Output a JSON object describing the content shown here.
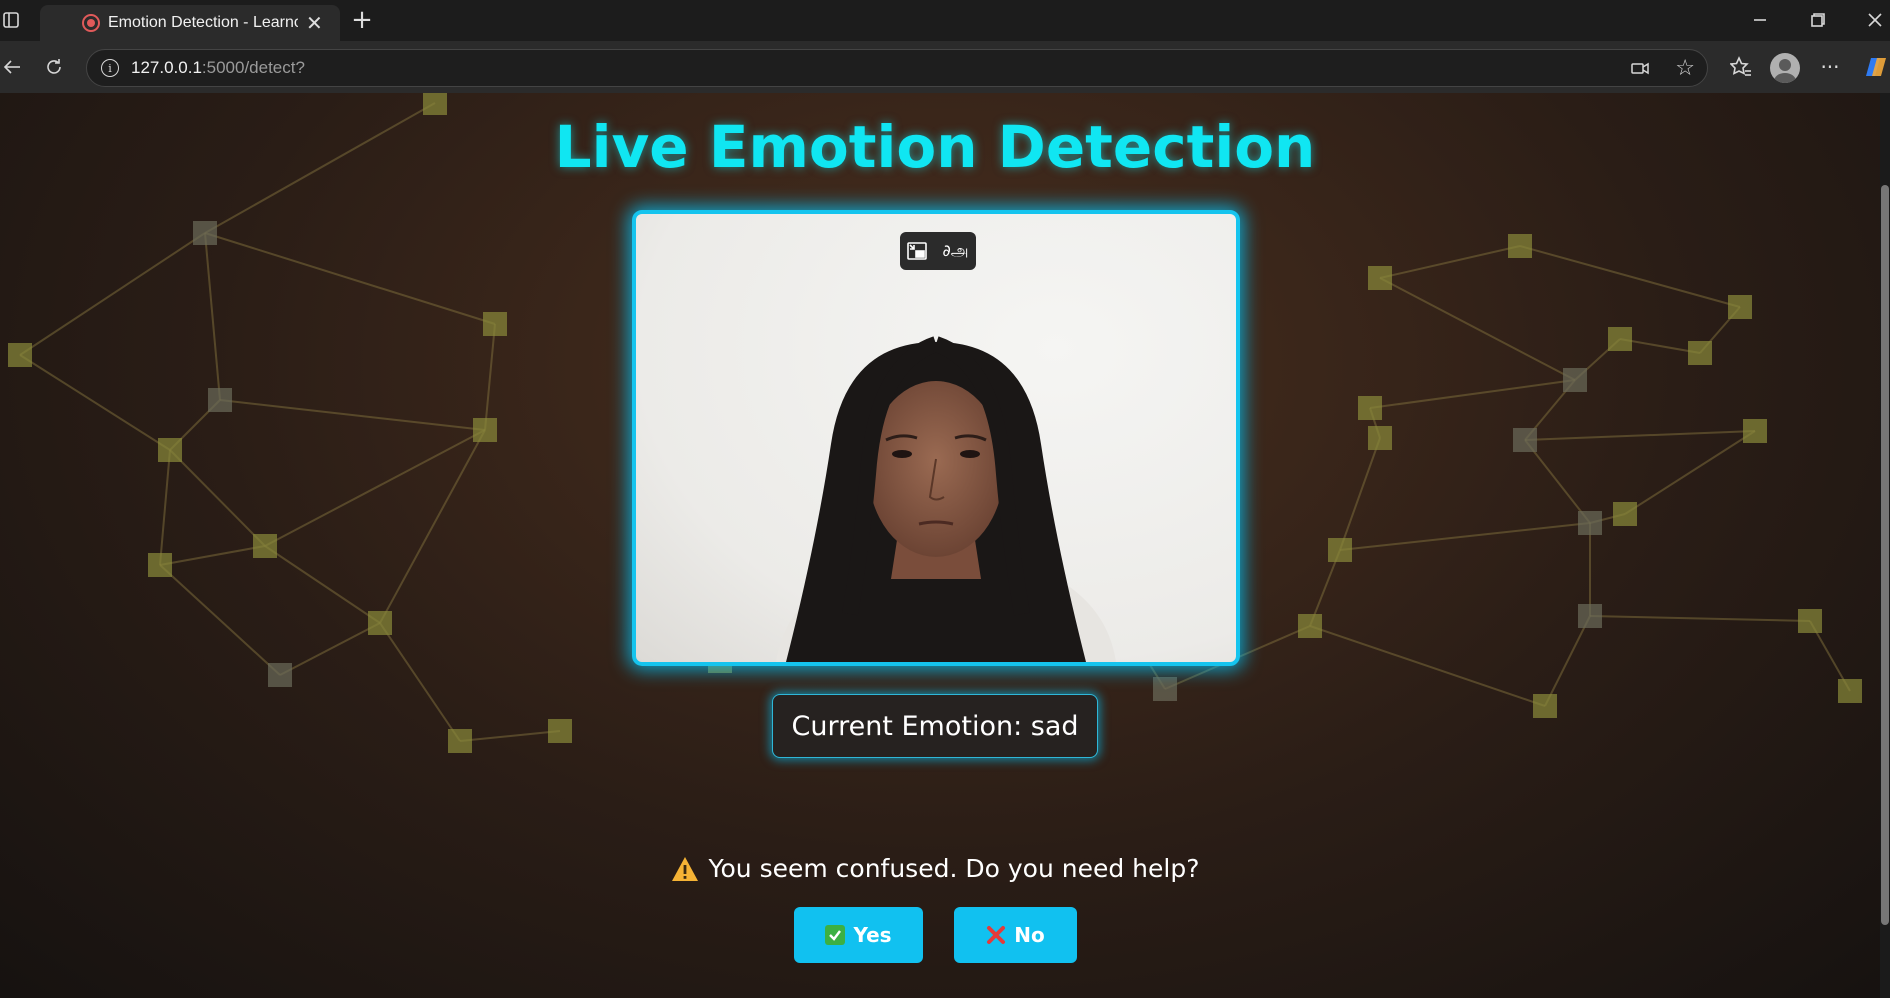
{
  "browser": {
    "tab_title": "Emotion Detection - Learnor",
    "url_host": "127.0.0.1",
    "url_rest": ":5000/detect?"
  },
  "page": {
    "title": "Live Emotion Detection",
    "emotion_label": "Current Emotion: sad",
    "prompt": "You seem confused. Do you need help?",
    "yes_label": "Yes",
    "no_label": "No"
  },
  "colors": {
    "accent_cyan": "#10e6f2",
    "button_blue": "#11c1f0",
    "frame_glow": "#15c4ee"
  },
  "icons": [
    "sidebar-toggle-icon",
    "globe-icon",
    "recording-icon",
    "close-icon",
    "new-tab-icon",
    "minimize-icon",
    "restore-icon",
    "window-close-icon",
    "back-icon",
    "reload-icon",
    "info-icon",
    "camera-icon",
    "star-icon",
    "favorites-icon",
    "profile-icon",
    "more-icon",
    "copilot-icon",
    "pip-icon",
    "translate-icon",
    "warning-icon",
    "check-icon",
    "cross-icon"
  ]
}
